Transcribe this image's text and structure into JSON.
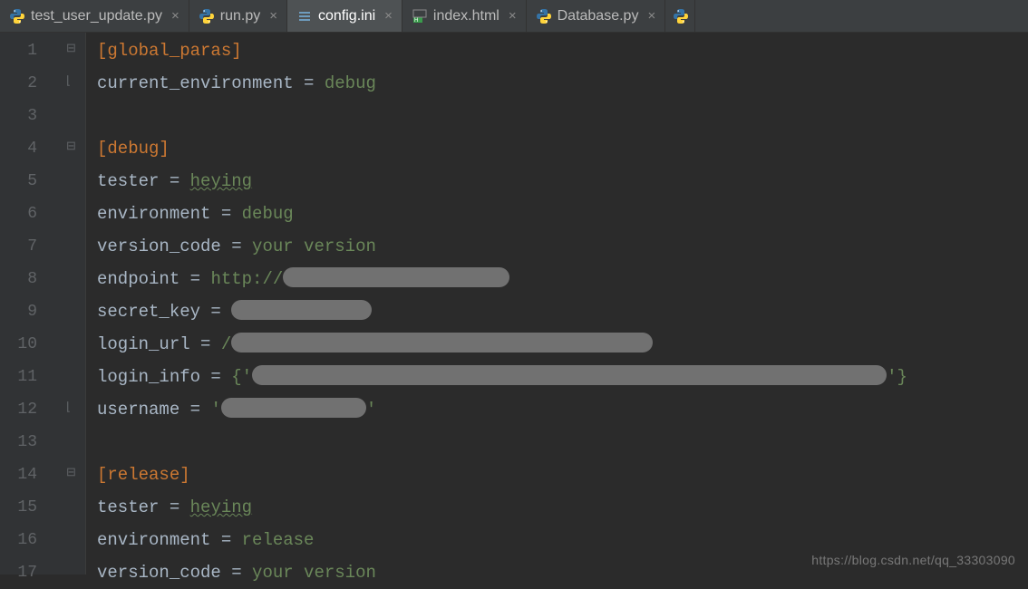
{
  "tabs": [
    {
      "label": "test_user_update.py",
      "type": "py",
      "active": false
    },
    {
      "label": "run.py",
      "type": "py",
      "active": false
    },
    {
      "label": "config.ini",
      "type": "ini",
      "active": true
    },
    {
      "label": "index.html",
      "type": "html",
      "active": false
    },
    {
      "label": "Database.py",
      "type": "py",
      "active": false
    }
  ],
  "close_glyph": "×",
  "line_numbers": [
    "1",
    "2",
    "3",
    "4",
    "5",
    "6",
    "7",
    "8",
    "9",
    "10",
    "11",
    "12",
    "13",
    "14",
    "15",
    "16",
    "17"
  ],
  "code": {
    "section_global": "[global_paras]",
    "k_current_env": "current_environment",
    "k_tester": "tester",
    "k_environment": "environment",
    "k_version_code": "version_code",
    "k_endpoint": "endpoint",
    "k_secret_key": "secret_key",
    "k_login_url": "login_url",
    "k_login_info": "login_info",
    "k_username": "username",
    "eq": " = ",
    "v_debug": "debug",
    "section_debug": "[debug]",
    "v_tester": "heying",
    "v_version": "your version",
    "v_http": "http://",
    "v_login_url_prefix": "/",
    "v_login_info_open": "{'",
    "v_login_info_close": "'}",
    "v_username_q1": "'",
    "v_username_q2": "'",
    "section_release": "[release]",
    "v_release": "release"
  },
  "watermark": "https://blog.csdn.net/qq_33303090"
}
